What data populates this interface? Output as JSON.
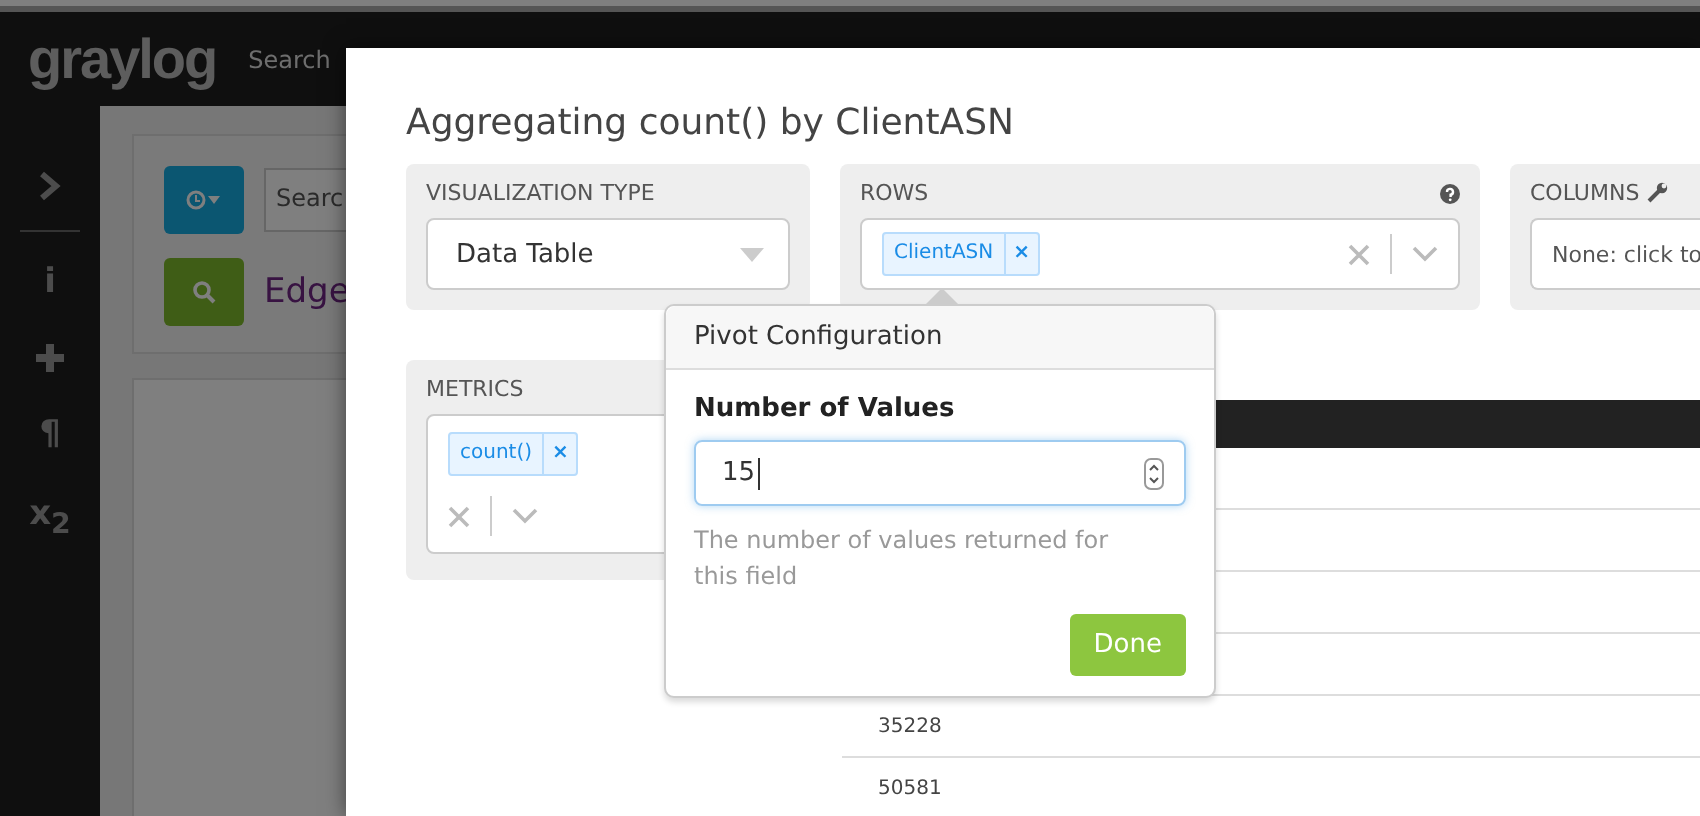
{
  "topbar": {
    "logo": "graylog",
    "nav": [
      "Search"
    ]
  },
  "sidebar": {
    "items": [
      "i",
      "¶",
      "x$_{2}$"
    ]
  },
  "search_bar": {
    "query": "Searc",
    "title": "Edge"
  },
  "modal": {
    "title": "Aggregating count() by ClientASN",
    "visualization_type": {
      "label": "VISUALIZATION TYPE",
      "value": "Data Table"
    },
    "rows": {
      "label": "ROWS",
      "chips": [
        {
          "text": "ClientASN",
          "remove": "×"
        }
      ]
    },
    "columns": {
      "label": "COLUMNS",
      "placeholder": "None: click to"
    },
    "metrics": {
      "label": "METRICS",
      "chips": [
        {
          "text": "count()",
          "remove": "×"
        }
      ]
    },
    "table": {
      "rows": [
        "35228",
        "50581"
      ]
    },
    "popover": {
      "title": "Pivot Configuration",
      "field_label": "Number of Values",
      "value": "15",
      "help": "The number of values returned for this field",
      "button": "Done"
    }
  }
}
